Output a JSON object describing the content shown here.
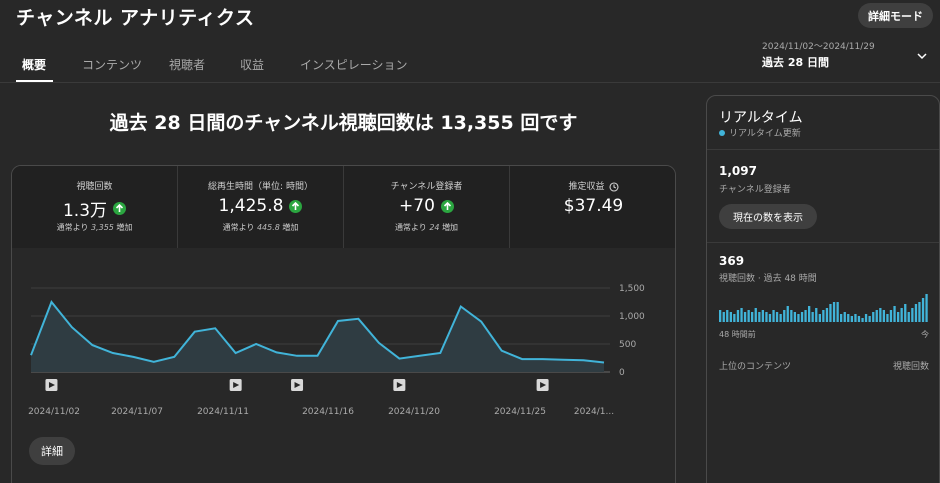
{
  "header": {
    "title": "チャンネル アナリティクス",
    "advanced_mode": "詳細モード"
  },
  "tabs": [
    {
      "label": "概要",
      "active": true
    },
    {
      "label": "コンテンツ",
      "active": false
    },
    {
      "label": "視聴者",
      "active": false
    },
    {
      "label": "収益",
      "active": false
    },
    {
      "label": "インスピレーション",
      "active": false
    }
  ],
  "date_picker": {
    "range": "2024/11/02～2024/11/29",
    "label": "過去 28 日間"
  },
  "headline": "過去 28 日間のチャンネル視聴回数は 13,355 回です",
  "metrics": [
    {
      "label": "視聴回数",
      "value": "1.3万",
      "trend": "up",
      "note_prefix": "通常より",
      "note_value": "3,355",
      "note_suffix": "増加"
    },
    {
      "label": "総再生時間（単位: 時間）",
      "value": "1,425.8",
      "trend": "up",
      "note_prefix": "通常より",
      "note_value": "445.8",
      "note_suffix": "増加"
    },
    {
      "label": "チャンネル登録者",
      "value": "+70",
      "trend": "up",
      "note_prefix": "通常より",
      "note_value": "24",
      "note_suffix": "増加"
    },
    {
      "label": "推定収益",
      "value": "$37.49",
      "trend": "none",
      "note_prefix": "",
      "note_value": "",
      "note_suffix": ""
    }
  ],
  "chart_data": {
    "type": "area",
    "x": [
      "2024/11/01",
      "2024/11/02",
      "2024/11/03",
      "2024/11/04",
      "2024/11/05",
      "2024/11/06",
      "2024/11/07",
      "2024/11/08",
      "2024/11/09",
      "2024/11/10",
      "2024/11/11",
      "2024/11/12",
      "2024/11/13",
      "2024/11/14",
      "2024/11/15",
      "2024/11/16",
      "2024/11/17",
      "2024/11/18",
      "2024/11/19",
      "2024/11/20",
      "2024/11/21",
      "2024/11/22",
      "2024/11/23",
      "2024/11/24",
      "2024/11/25",
      "2024/11/26",
      "2024/11/27",
      "2024/11/28",
      "2024/11/29"
    ],
    "values": [
      300,
      1250,
      800,
      480,
      340,
      270,
      180,
      270,
      720,
      780,
      340,
      500,
      350,
      290,
      290,
      910,
      950,
      520,
      240,
      290,
      340,
      1170,
      900,
      380,
      230,
      230,
      220,
      210,
      170
    ],
    "x_tick_labels": [
      "2024/11/02",
      "2024/11/07",
      "2024/11/11",
      "2024/11/16",
      "2024/11/20",
      "2024/11/25",
      "2024/1..."
    ],
    "y_ticks": [
      "1,500",
      "1,000",
      "500",
      "0"
    ],
    "ylim": [
      0,
      1500
    ],
    "grid": true,
    "video_markers": [
      "2024/11/02",
      "2024/11/11",
      "2024/11/14",
      "2024/11/19",
      "2024/11/26"
    ],
    "color": "#41b4d9"
  },
  "details_button": "詳細",
  "realtime": {
    "title": "リアルタイム",
    "subtitle": "リアルタイム更新",
    "subscribers": "1,097",
    "subscribers_label": "チャンネル登録者",
    "show_count_button": "現在の数を表示",
    "views": "369",
    "views_label": "視聴回数 · 過去 48 時間",
    "bars": [
      6,
      5,
      6,
      5,
      4,
      6,
      7,
      5,
      6,
      5,
      7,
      5,
      6,
      5,
      4,
      6,
      5,
      4,
      6,
      8,
      6,
      5,
      4,
      5,
      6,
      8,
      5,
      7,
      4,
      6,
      7,
      9,
      10,
      10,
      4,
      5,
      4,
      3,
      4,
      3,
      2,
      4,
      3,
      5,
      6,
      7,
      6,
      4,
      6,
      8,
      5,
      7,
      9,
      5,
      7,
      9,
      10,
      12,
      14
    ],
    "axis_left": "48 時間前",
    "axis_right": "今",
    "top_content_label": "上位のコンテンツ",
    "top_content_metric": "視聴回数"
  }
}
